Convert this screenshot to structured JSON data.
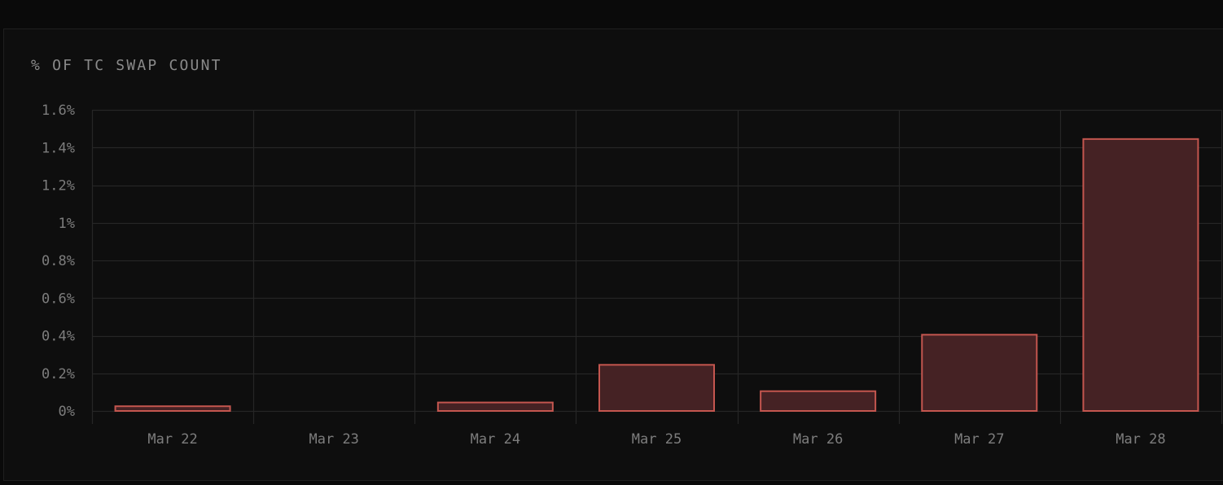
{
  "panel": {
    "title": "% OF TC SWAP COUNT"
  },
  "colors": {
    "page_background": "#0a0a0a",
    "panel_background": "#0e0e0e",
    "grid": "#262626",
    "bar_fill": "#452224",
    "bar_stroke": "#c4564f",
    "tick_text": "#7d7d7d",
    "title_text": "#8a8a8a"
  },
  "chart_data": {
    "type": "bar",
    "title": "% OF TC SWAP COUNT",
    "xlabel": "",
    "ylabel": "",
    "categories": [
      "Mar 22",
      "Mar 23",
      "Mar 24",
      "Mar 25",
      "Mar 26",
      "Mar 27",
      "Mar 28"
    ],
    "values": [
      0.025,
      0,
      0.045,
      0.245,
      0.105,
      0.405,
      1.445
    ],
    "ylim": [
      0,
      1.6
    ],
    "y_ticks": [
      0,
      0.2,
      0.4,
      0.6,
      0.8,
      1,
      1.2,
      1.4,
      1.6
    ],
    "y_tick_labels": [
      "0%",
      "0.2%",
      "0.4%",
      "0.6%",
      "0.8%",
      "1%",
      "1.2%",
      "1.4%",
      "1.6%"
    ],
    "grid": true,
    "legend": "none"
  }
}
